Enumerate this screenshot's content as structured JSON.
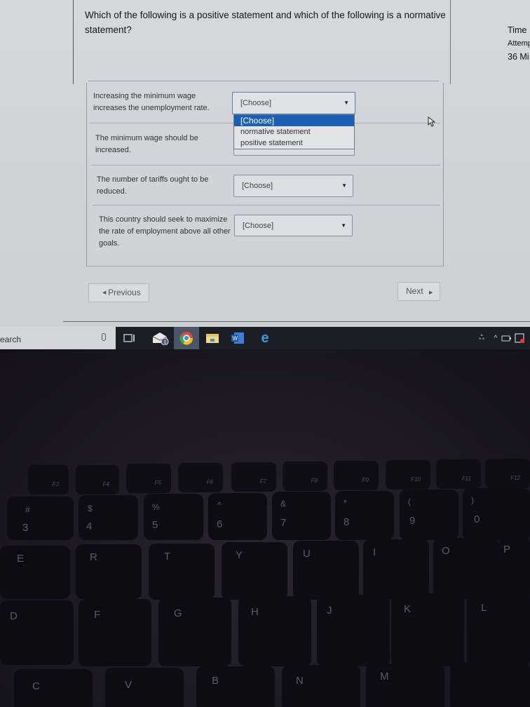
{
  "question": {
    "title": "Which of the following is a positive statement and which of the following is a normative statement?"
  },
  "sidebar": {
    "time_label": "Time",
    "attempt_label": "Attemp",
    "minutes_label": "36 Mi"
  },
  "rows": [
    {
      "statement": "Increasing the minimum wage increases the unemployment rate.",
      "selected": "[Choose]",
      "open": true
    },
    {
      "statement": "The minimum wage should be increased.",
      "selected": "[Choose]",
      "open": false
    },
    {
      "statement": "The number of tariffs ought to be reduced.",
      "selected": "[Choose]",
      "open": false
    },
    {
      "statement": "This country should seek to maximize the rate of employment above all other goals.",
      "selected": "[Choose]",
      "open": false
    }
  ],
  "dropdown": {
    "options": [
      "[Choose]",
      "normative statement",
      "positive statement"
    ],
    "highlighted_index": 0
  },
  "navigation": {
    "previous_label": "Previous",
    "next_label": "Next"
  },
  "taskbar": {
    "search_text": "earch",
    "mail_badge": "1",
    "word_letter": "W",
    "ie_letter": "e"
  },
  "keyboard": {
    "fn_row": [
      "F3",
      "F4",
      "F5",
      "F6",
      "F7",
      "F8",
      "F9",
      "F10",
      "F11",
      "F12"
    ],
    "number_row": [
      {
        "top": "#",
        "main": "3"
      },
      {
        "top": "$",
        "main": "4"
      },
      {
        "top": "%",
        "main": "5"
      },
      {
        "top": "^",
        "main": "6"
      },
      {
        "top": "&",
        "main": "7"
      },
      {
        "top": "*",
        "main": "8"
      },
      {
        "top": "(",
        "main": "9"
      },
      {
        "top": ")",
        "main": "0"
      }
    ],
    "row_qwerty": [
      "E",
      "R",
      "T",
      "Y",
      "U",
      "I",
      "O",
      "P"
    ],
    "row_home": [
      "D",
      "F",
      "G",
      "H",
      "J",
      "K",
      "L"
    ],
    "row_bottom": [
      "C",
      "V",
      "B",
      "N",
      "M"
    ]
  },
  "colors": {
    "highlight": "#1a5fb4"
  }
}
